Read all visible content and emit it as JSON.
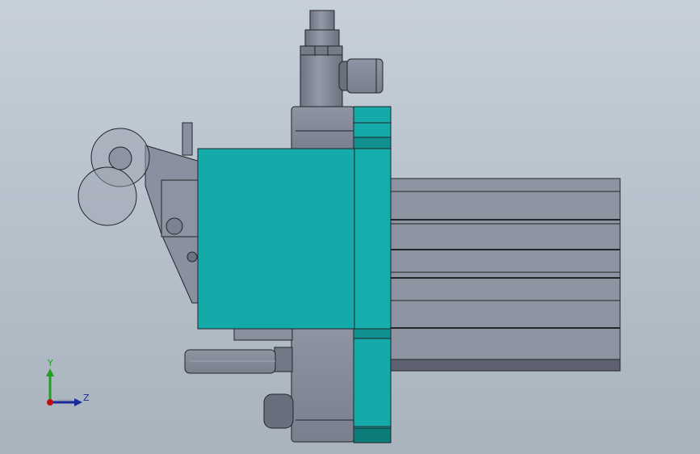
{
  "viewport": {
    "background_top": "#c7d0da",
    "background_bottom": "#a9b3bd"
  },
  "model": {
    "colors": {
      "teal_face": "#14aaa9",
      "teal_dark": "#0d7d7b",
      "steel_light": "#8e93a2",
      "steel_mid": "#7d8292",
      "steel_dark": "#5f6371",
      "edge": "#222428"
    }
  },
  "triad": {
    "y_label": "Y",
    "z_label": "Z",
    "colors": {
      "y_axis": "#20a020",
      "z_axis": "#1a2a9a",
      "x_axis": "#c01010"
    }
  }
}
